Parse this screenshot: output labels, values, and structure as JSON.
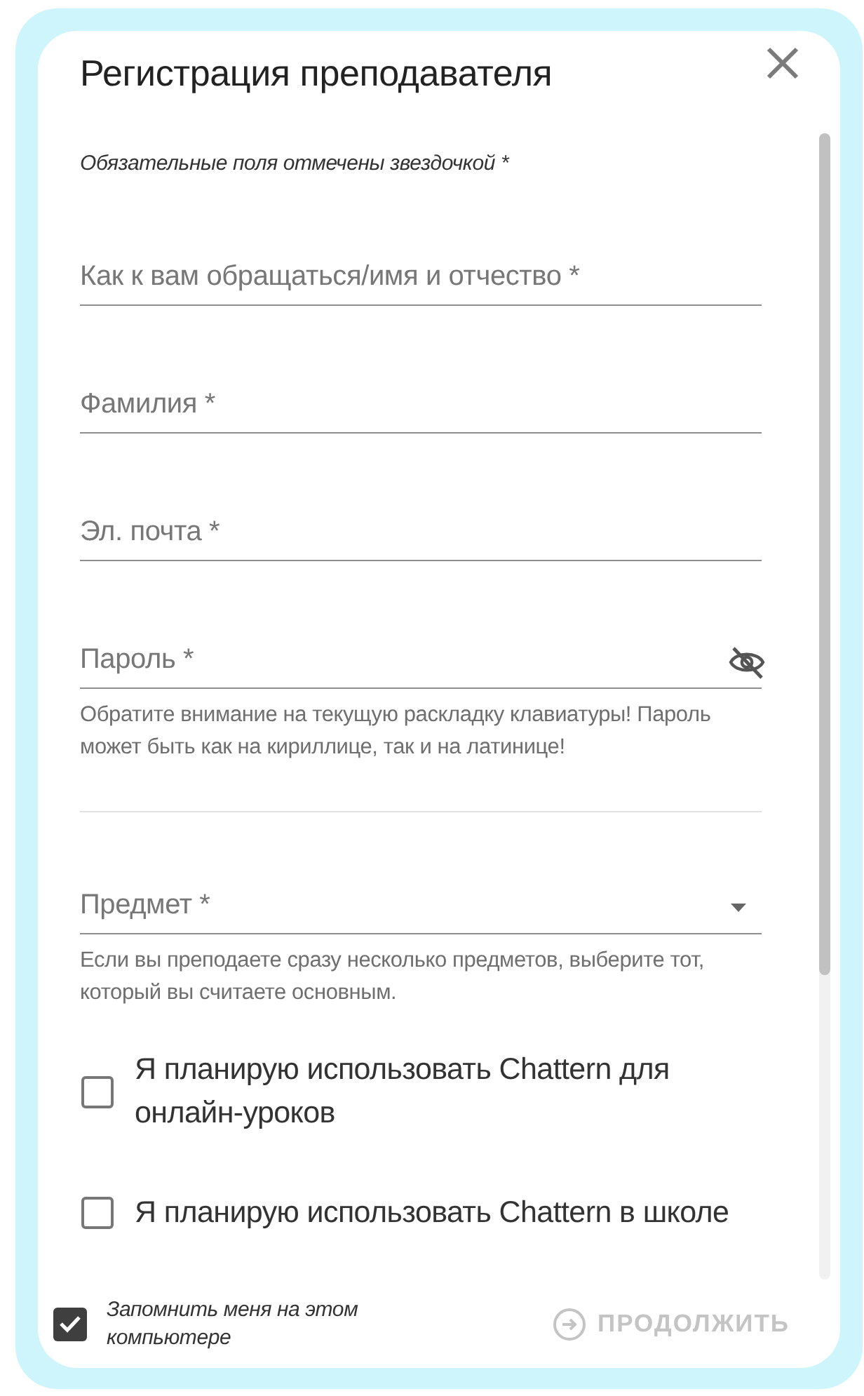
{
  "dialog": {
    "title": "Регистрация преподавателя"
  },
  "required_note": "Обязательные поля отмечены звездочкой *",
  "account_fields": [
    {
      "kind": "text",
      "placeholder": "Как к вам обращаться/имя и отчество *"
    },
    {
      "kind": "text",
      "placeholder": "Фамилия *"
    },
    {
      "kind": "text",
      "placeholder": "Эл. почта *"
    },
    {
      "kind": "password",
      "placeholder": "Пароль *",
      "revealed": false,
      "helper": "Обратите внимание на текущую раскладку клавиатуры! Пароль может быть как на кириллице, так и на латинице!"
    }
  ],
  "subject_fields": [
    {
      "kind": "select",
      "placeholder": "Предмет *",
      "helper": "Если вы преподаете сразу несколько предметов, выберите тот, который вы считаете основным."
    }
  ],
  "options": [
    {
      "label": "Я планирую использовать Chattern для онлайн-уроков",
      "checked": false
    },
    {
      "label": "Я планирую использовать Chattern в школе",
      "checked": false
    }
  ],
  "footer": {
    "remember_me": {
      "label": "Запомнить меня на этом компьютере",
      "checked": true
    },
    "continue_button": {
      "label": "ПРОДОЛЖИТЬ",
      "disabled": true
    }
  }
}
